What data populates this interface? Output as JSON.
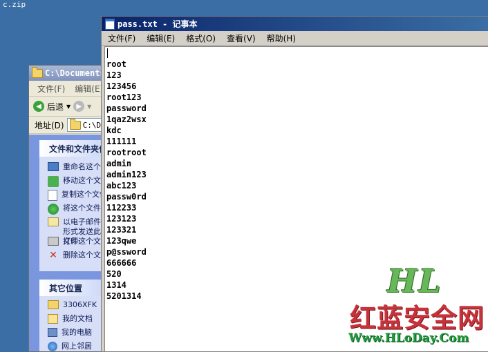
{
  "desktop": {
    "file_label": "c.zip"
  },
  "explorer": {
    "title": "C:\\Documents",
    "menu": [
      "文件(F)",
      "编辑(E)"
    ],
    "toolbar": {
      "back_label": "后退"
    },
    "address": {
      "label": "地址(D)",
      "value": "C:\\D"
    },
    "tasks": {
      "header": "文件和文件夹任务",
      "items": [
        "重命名这个文件",
        "移动这个文件",
        "复制这个文件",
        "将这个文件发布到 Web",
        "以电子邮件形式发送此文件",
        "打印这个文件",
        "删除这个文件"
      ]
    },
    "places": {
      "header": "其它位置",
      "items": [
        "3306XFK",
        "我的文档",
        "我的电脑",
        "网上邻居"
      ]
    }
  },
  "notepad": {
    "title": "pass.txt - 记事本",
    "menu": [
      "文件(F)",
      "编辑(E)",
      "格式(O)",
      "查看(V)",
      "帮助(H)"
    ],
    "lines": [
      "root",
      "123",
      "123456",
      "root123",
      "password",
      "1qaz2wsx",
      "kdc",
      "111111",
      "rootroot",
      "admin",
      "admin123",
      "abc123",
      "passw0rd",
      "112233",
      "123123",
      "123321",
      "123qwe",
      "p@ssword",
      "666666",
      "520",
      "1314",
      "5201314"
    ]
  },
  "watermark": {
    "logo": "HL",
    "name": "红蓝安全网",
    "url": "Www.HLoDay.Com"
  }
}
